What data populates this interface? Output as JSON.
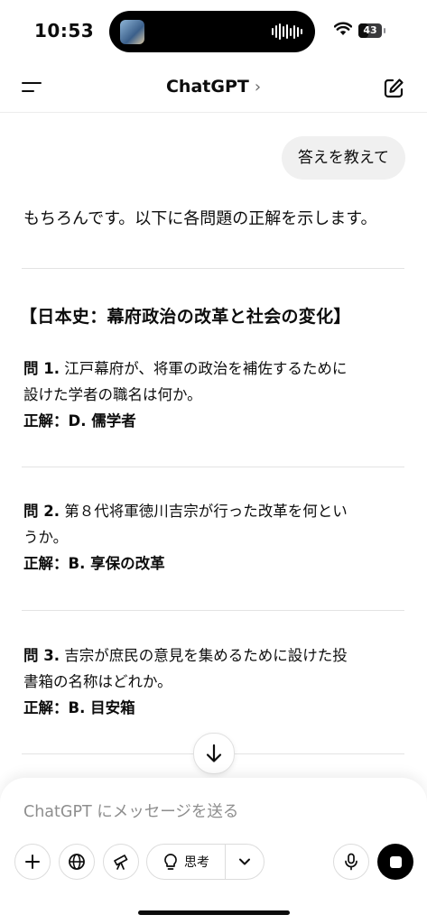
{
  "status_bar": {
    "time": "10:53",
    "battery_level": "43",
    "battery_fraction": 0.43
  },
  "header": {
    "title": "ChatGPT",
    "title_chevron": "chevron-right-icon",
    "menu_icon": "menu-icon",
    "edit_icon": "new-chat-icon"
  },
  "chat": {
    "user_message": "答えを教えて",
    "intro": "もちろんです。以下に各問題の正解を示します。",
    "section_title": "【日本史：幕府政治の改革と社会の変化】",
    "questions": [
      {
        "label": "問 1.",
        "text_line1": "江戸幕府が、将軍の政治を補佐するために",
        "text_line2": "設けた学者の職名は何か。",
        "answer": "正解：D. 儒学者"
      },
      {
        "label": "問 2.",
        "text_line1": "第８代将軍徳川吉宗が行った改革を何とい",
        "text_line2": "うか。",
        "answer": "正解：B. 享保の改革"
      },
      {
        "label": "問 3.",
        "text_line1": "吉宗が庶民の意見を集めるために設けた投",
        "text_line2": "書箱の名称はどれか。",
        "answer": "正解：B. 目安箱"
      }
    ]
  },
  "composer": {
    "placeholder": "ChatGPT にメッセージを送る",
    "think_label": "思考",
    "icons": [
      "plus-icon",
      "globe-icon",
      "telescope-icon",
      "lightbulb-icon",
      "chevron-down-icon",
      "microphone-icon",
      "stop-icon"
    ]
  },
  "colors": {
    "background": "#ffffff",
    "text": "#0d0d0d",
    "bubble": "#f0f0f0",
    "placeholder": "#8e8e8e",
    "divider": "#e3e3e3"
  }
}
